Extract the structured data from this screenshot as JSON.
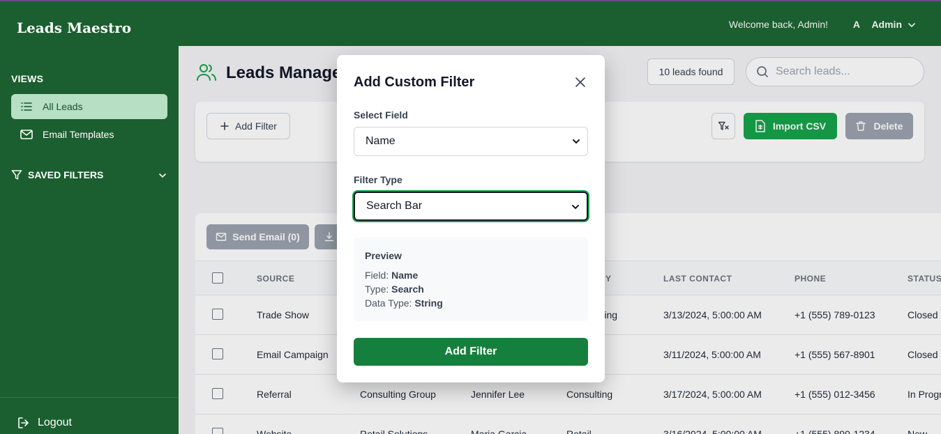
{
  "app": {
    "brand": "Leads Maestro"
  },
  "sidebar": {
    "views_title": "VIEWS",
    "items": [
      {
        "label": "All Leads",
        "icon": "list-icon",
        "active": true
      },
      {
        "label": "Email Templates",
        "icon": "mail-icon",
        "active": false
      }
    ],
    "saved_filters_title": "SAVED FILTERS",
    "logout_label": "Logout"
  },
  "header": {
    "welcome": "Welcome back, Admin!",
    "avatar_initial": "A",
    "user_name": "Admin"
  },
  "main": {
    "title": "Leads Manage",
    "leads_found": "10 leads found",
    "search_placeholder": "Search leads...",
    "add_filter_label": "Add Filter",
    "import_label": "Import CSV",
    "delete_label": "Delete",
    "send_email_label": "Send Email (0)"
  },
  "table": {
    "columns": [
      "SOURCE",
      "Y",
      "LAST CONTACT",
      "PHONE",
      "STATUS"
    ],
    "rows": [
      {
        "source": "Trade Show",
        "company": "",
        "contact": "",
        "industry": "turing",
        "last_contact": "3/13/2024, 5:00:00 AM",
        "phone": "+1 (555) 789-0123",
        "status": "Closed"
      },
      {
        "source": "Email Campaign",
        "company": "",
        "contact": "",
        "industry": "",
        "last_contact": "3/11/2024, 5:00:00 AM",
        "phone": "+1 (555) 567-8901",
        "status": "Closed"
      },
      {
        "source": "Referral",
        "company": "Consulting Group",
        "contact": "Jennifer Lee",
        "industry": "Consulting",
        "last_contact": "3/17/2024, 5:00:00 AM",
        "phone": "+1 (555) 012-3456",
        "status": "In Progr"
      },
      {
        "source": "Website",
        "company": "Retail Solutions",
        "contact": "Maria Garcia",
        "industry": "Retail",
        "last_contact": "3/16/2024, 5:00:00 AM",
        "phone": "+1 (555) 890-1234",
        "status": "New"
      }
    ]
  },
  "modal": {
    "title": "Add Custom Filter",
    "field_label": "Select Field",
    "field_value": "Name",
    "type_label": "Filter Type",
    "type_value": "Search Bar",
    "preview_title": "Preview",
    "preview": {
      "field_key": "Field: ",
      "field_val": "Name",
      "type_key": "Type: ",
      "type_val": "Search",
      "datatype_key": "Data Type: ",
      "datatype_val": "String"
    },
    "submit_label": "Add Filter"
  },
  "colors": {
    "brand_green": "#1b5e2f",
    "accent_green": "#16a34a",
    "active_nav": "#b7dfc3"
  }
}
